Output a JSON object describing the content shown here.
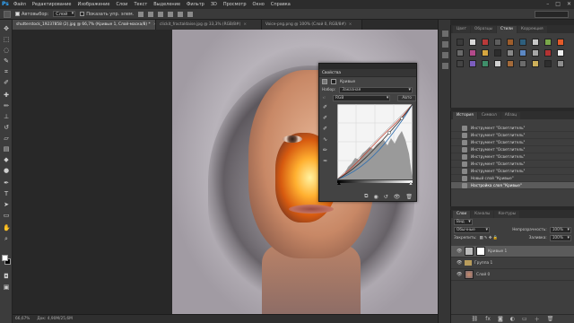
{
  "app": {
    "logo": "Ps"
  },
  "menu": [
    "Файл",
    "Редактирование",
    "Изображение",
    "Слои",
    "Текст",
    "Выделение",
    "Фильтр",
    "3D",
    "Просмотр",
    "Окно",
    "Справка"
  ],
  "window_controls": [
    "–",
    "□",
    "✕"
  ],
  "options": {
    "autoselect_label": "Автовыбор:",
    "autoselect_value": "Слой",
    "transform_label": "Показать упр. элем."
  },
  "tabs": [
    {
      "label": "shutterstock_19237858 (2).jpg @ 66,7% (Кривые 1, Слой-маска/8) *",
      "active": true
    },
    {
      "label": "clickit_fractaldaise.jpg @ 33,3% (RGB/8#)",
      "active": false
    },
    {
      "label": "Voice-png.png @ 100% (Слой 0, RGB/8#)",
      "active": false
    }
  ],
  "status": {
    "zoom": "66,67%",
    "doc": "Док: 4,90M/25,6M"
  },
  "properties": {
    "tab": "Свойства",
    "title": "Кривые",
    "preset_label": "Набор:",
    "preset_value": "Заказная",
    "channel_value": "RGB",
    "auto_label": "Авто"
  },
  "swatch_panel": {
    "tabs": [
      "Цвет",
      "Образцы",
      "Стили",
      "Коррекция"
    ],
    "active": 2,
    "colors": [
      "#3a3a3a",
      "#d9d9d9",
      "#b93a3a",
      "#5e5e5e",
      "#9e5d2b",
      "#2e5f7d",
      "#c8c8c8",
      "#7aa84a",
      "#e45b2a",
      "#6a6a6a",
      "#b34a8a",
      "#d6a640",
      "#2c2c2c",
      "#888888",
      "#5c88c4",
      "#a7a7a7",
      "#b33333",
      "#f0f0f0",
      "#444444",
      "#7b5dbe",
      "#3f8f6a",
      "#d0d0d0",
      "#a36a3a",
      "#6c6c6c",
      "#cdb05a",
      "#2e2e2e",
      "#8e8e8e"
    ]
  },
  "history": {
    "tabs": [
      "История",
      "Символ",
      "Абзац"
    ],
    "items": [
      "Инструмент \"Осветлитель\"",
      "Инструмент \"Осветлитель\"",
      "Инструмент \"Осветлитель\"",
      "Инструмент \"Осветлитель\"",
      "Инструмент \"Осветлитель\"",
      "Инструмент \"Осветлитель\"",
      "Инструмент \"Осветлитель\"",
      "Новый слой \"Кривые\"",
      "Настройка слоя \"Кривые\""
    ],
    "active_index": 8
  },
  "layers": {
    "tabs": [
      "Слои",
      "Каналы",
      "Контуры"
    ],
    "kind_label": "Вид",
    "blend_mode": "Обычные",
    "opacity_label": "Непрозрачность:",
    "opacity_value": "100%",
    "lock_label": "Закрепить:",
    "fill_label": "Заливка:",
    "fill_value": "100%",
    "items": [
      {
        "name": "Кривые 1",
        "type": "adjustment",
        "active": true
      },
      {
        "name": "Группа 1",
        "type": "group",
        "active": false
      },
      {
        "name": "Слой 0",
        "type": "image",
        "active": false
      }
    ]
  }
}
